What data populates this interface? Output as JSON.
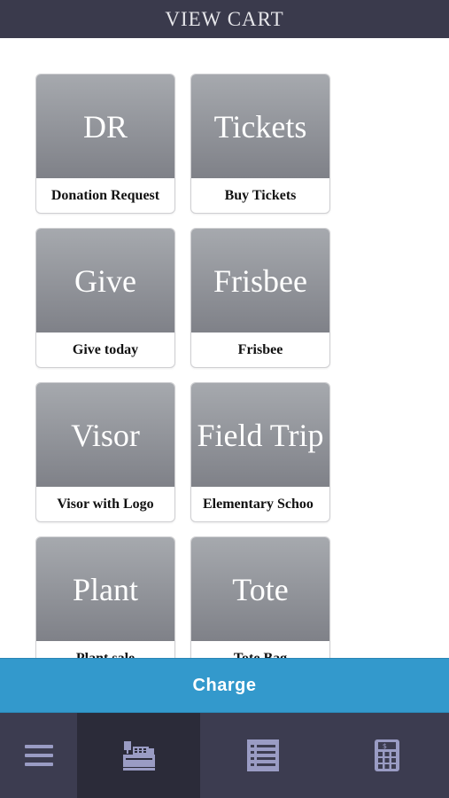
{
  "header": {
    "title": "VIEW CART"
  },
  "tiles": [
    {
      "abbr": "DR",
      "label": "Donation Request"
    },
    {
      "abbr": "Tickets",
      "label": "Buy Tickets"
    },
    {
      "abbr": "Give",
      "label": "Give today"
    },
    {
      "abbr": "Frisbee",
      "label": "Frisbee"
    },
    {
      "abbr": "Visor",
      "label": "Visor with Logo"
    },
    {
      "abbr": "Field Trip",
      "label": "Elementary Schoo"
    },
    {
      "abbr": "Plant",
      "label": "Plant sale"
    },
    {
      "abbr": "Tote",
      "label": "Tote Bag"
    }
  ],
  "charge_button": {
    "label": "Charge"
  },
  "bottom_nav": [
    {
      "icon": "menu-icon",
      "active": false
    },
    {
      "icon": "cash-register-icon",
      "active": true
    },
    {
      "icon": "list-icon",
      "active": false
    },
    {
      "icon": "calculator-icon",
      "active": false
    }
  ],
  "colors": {
    "header_bg": "#3a3a4c",
    "tile_gradient_top": "#a6a9ae",
    "tile_gradient_bottom": "#7f8188",
    "charge_bg": "#3399cc",
    "nav_bg": "#3c3c50",
    "nav_active_bg": "#2b2b39",
    "icon_color": "#9a9cc4"
  }
}
